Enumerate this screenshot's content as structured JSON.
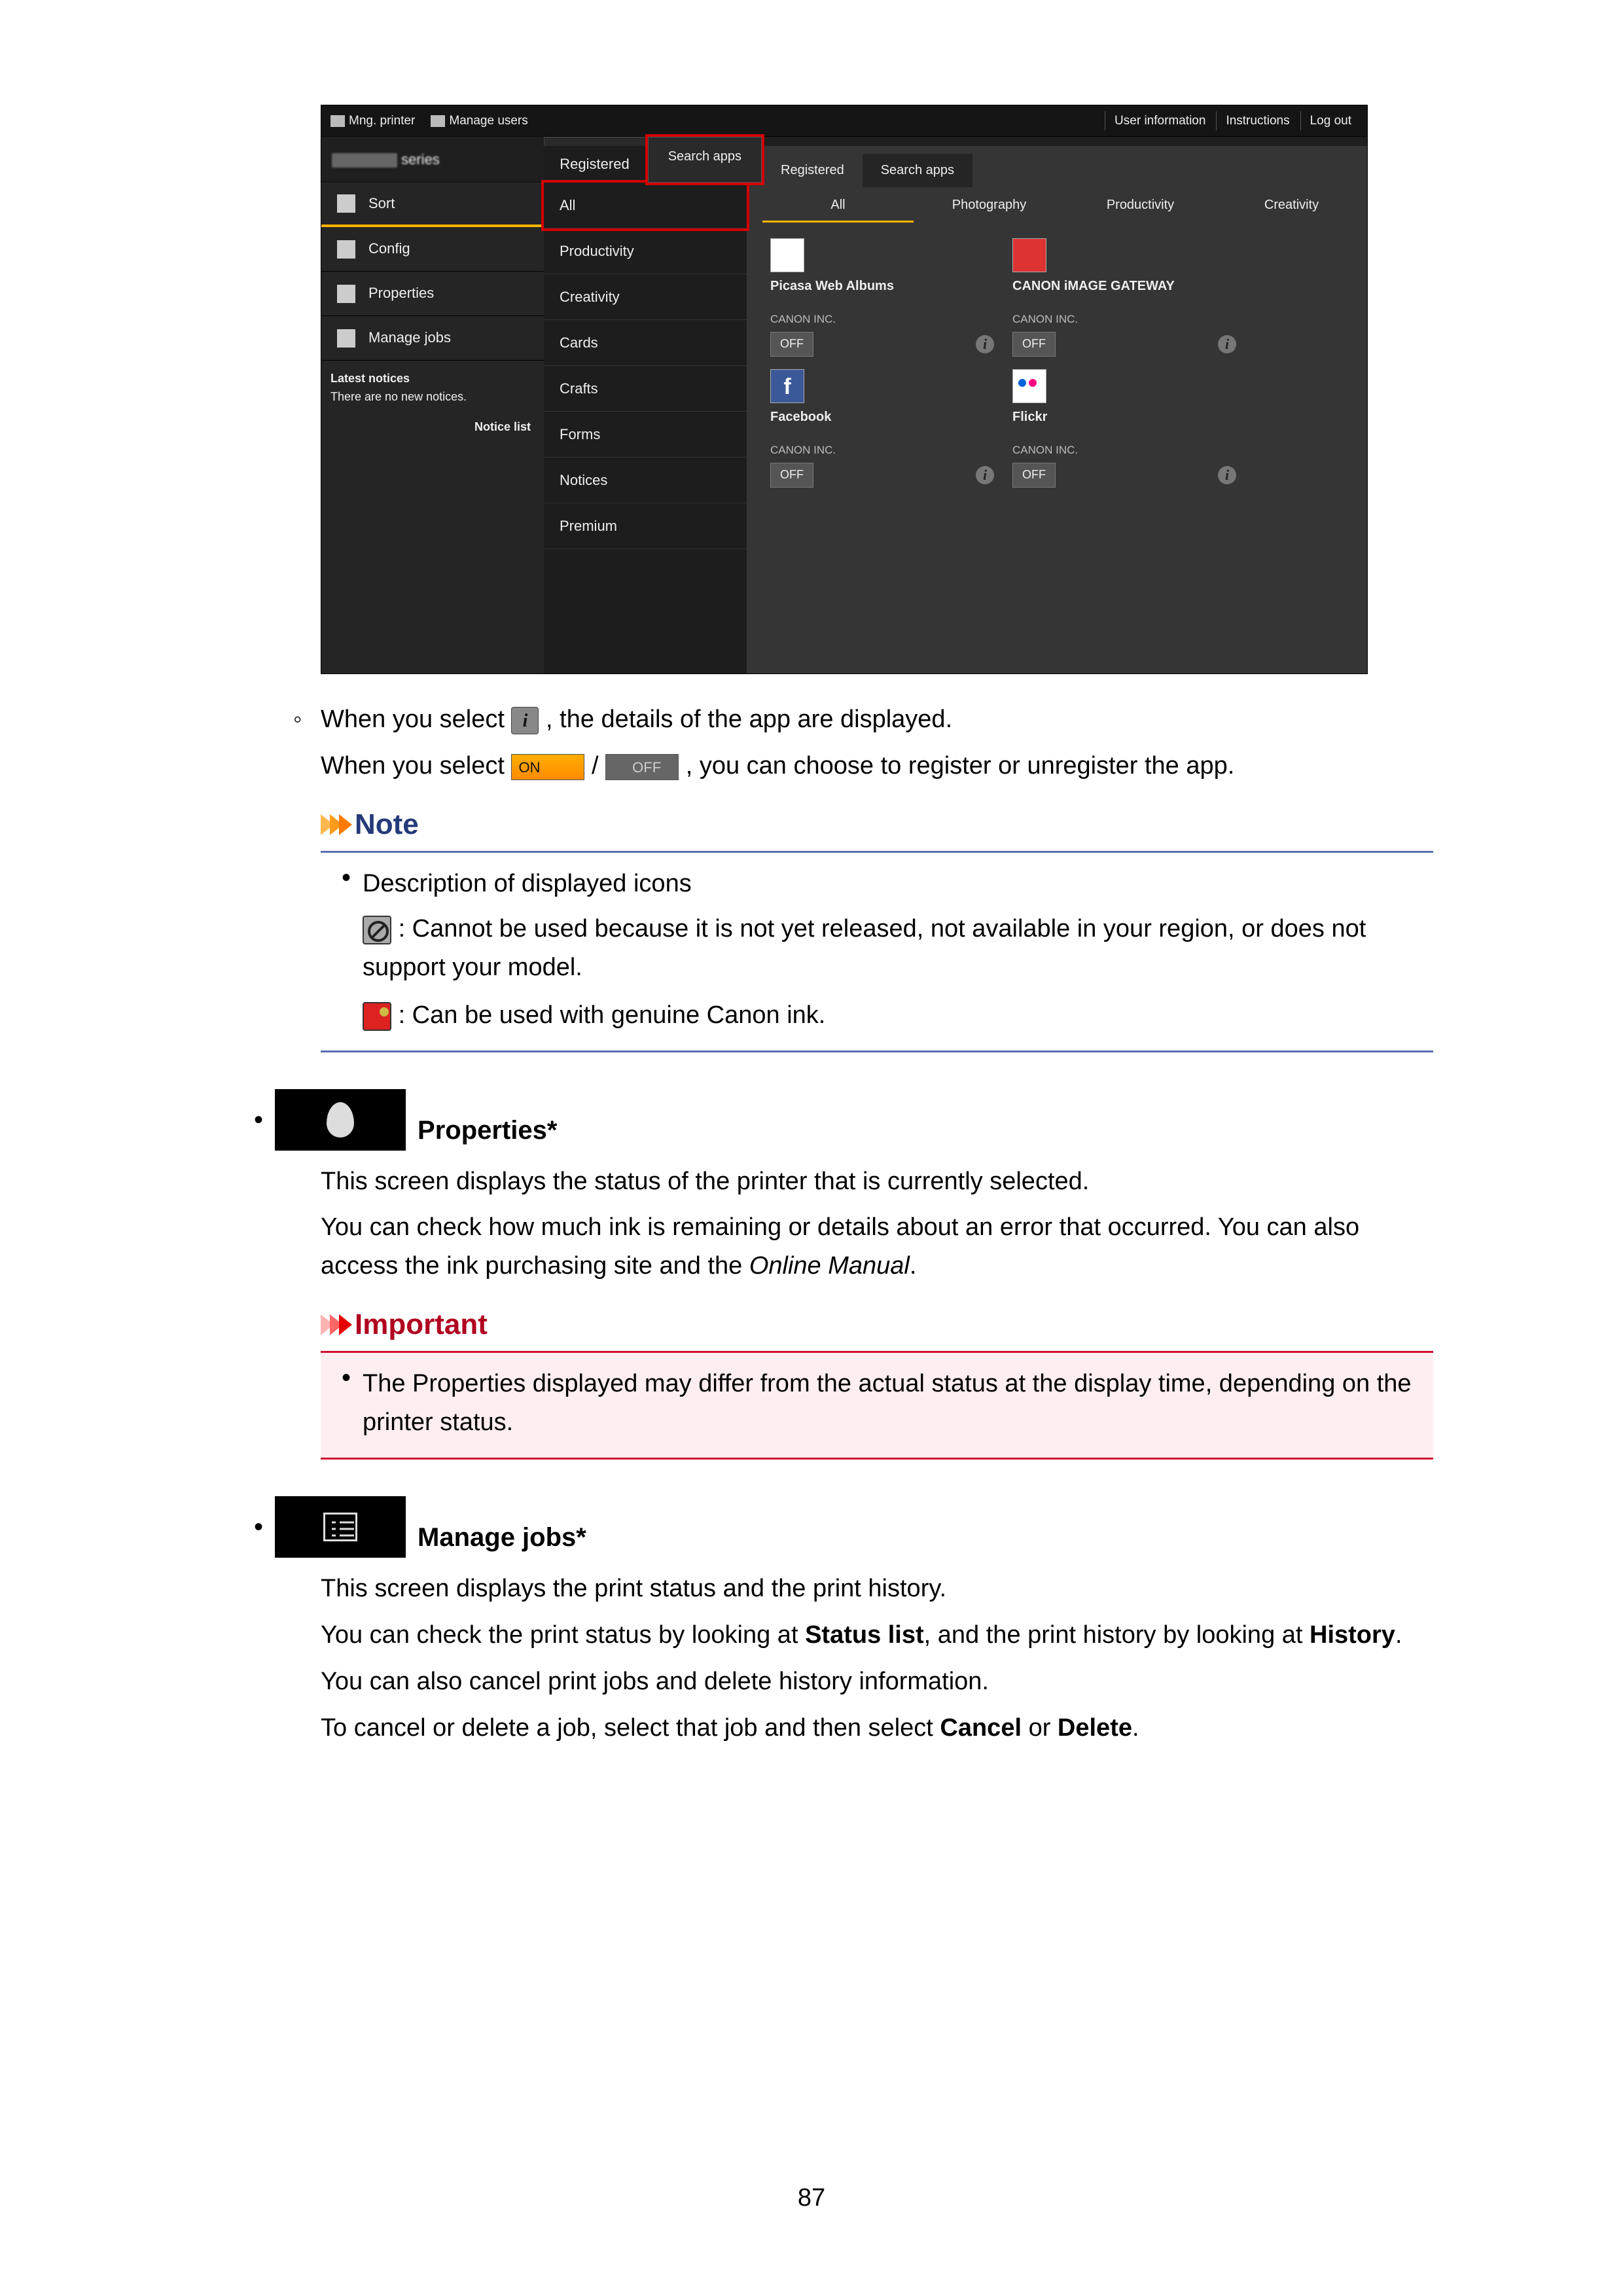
{
  "topbar": {
    "mng_printer": "Mng. printer",
    "manage_users": "Manage users",
    "user_info": "User information",
    "instructions": "Instructions",
    "logout": "Log out"
  },
  "series": "series",
  "left_tabs": {
    "registered": "Registered",
    "search_apps": "Search apps"
  },
  "sidebar": {
    "sort": "Sort",
    "config": "Config",
    "properties": "Properties",
    "manage_jobs": "Manage jobs",
    "latest": "Latest notices",
    "no_new": "There are no new notices.",
    "notice_list": "Notice list"
  },
  "categories": [
    "All",
    "Productivity",
    "Creativity",
    "Cards",
    "Crafts",
    "Forms",
    "Notices",
    "Premium"
  ],
  "right_tabs": {
    "registered": "Registered",
    "search_apps": "Search apps"
  },
  "right_cats": [
    "All",
    "Photography",
    "Productivity",
    "Creativity"
  ],
  "apps": [
    {
      "name": "Picasa Web Albums",
      "vendor": "CANON INC.",
      "state": "OFF",
      "thumb": "white"
    },
    {
      "name": "CANON iMAGE GATEWAY",
      "vendor": "CANON INC.",
      "state": "OFF",
      "thumb": "red"
    },
    {
      "name": "Facebook",
      "vendor": "CANON INC.",
      "state": "OFF",
      "thumb": "fb"
    },
    {
      "name": "Flickr",
      "vendor": "CANON INC.",
      "state": "OFF",
      "thumb": "flickr"
    }
  ],
  "body": {
    "l1a": "When you select ",
    "l1b": ", the details of the app are displayed.",
    "l2a": "When you select ",
    "l2_on": "ON",
    "l2_slash": " / ",
    "l2_off": "OFF",
    "l2b": ", you can choose to register or unregister the app.",
    "note_h": "Note",
    "note_li": "Description of displayed icons",
    "note_p1": " : Cannot be used because it is not yet released, not available in your region, or does not support your model.",
    "note_p2": " : Can be used with genuine Canon ink.",
    "prop_h": "Properties*",
    "prop_p1": "This screen displays the status of the printer that is currently selected.",
    "prop_p2a": "You can check how much ink is remaining or details about an error that occurred. You can also access the ink purchasing site and the ",
    "prop_p2b": "Online Manual",
    "prop_p2c": ".",
    "imp_h": "Important",
    "imp_li": "The Properties displayed may differ from the actual status at the display time, depending on the printer status.",
    "mj_h": "Manage jobs*",
    "mj_p1": "This screen displays the print status and the print history.",
    "mj_p2a": "You can check the print status by looking at ",
    "mj_p2b": "Status list",
    "mj_p2c": ", and the print history by looking at ",
    "mj_p2d": "History",
    "mj_p2e": ".",
    "mj_p3": "You can also cancel print jobs and delete history information.",
    "mj_p4a": "To cancel or delete a job, select that job and then select ",
    "mj_p4b": "Cancel",
    "mj_p4c": " or ",
    "mj_p4d": "Delete",
    "mj_p4e": "."
  },
  "page_number": "87"
}
